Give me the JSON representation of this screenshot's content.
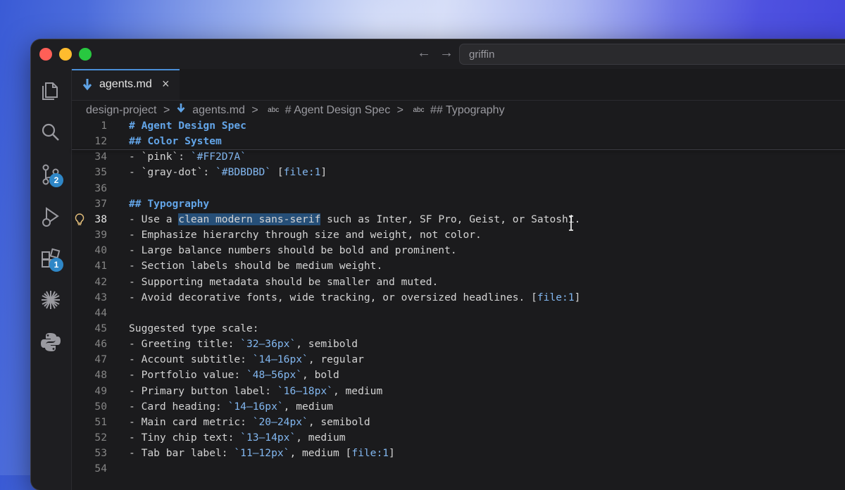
{
  "titlebar": {
    "search_text": "griffin"
  },
  "activity_bar": {
    "source_control_badge": "2",
    "extensions_badge": "1",
    "icons": [
      "explorer-icon",
      "search-icon",
      "source-control-icon",
      "run-debug-icon",
      "extensions-icon",
      "sparkle-icon",
      "python-icon"
    ]
  },
  "tab": {
    "filename": "agents.md"
  },
  "breadcrumb": {
    "folder": "design-project",
    "file": "agents.md",
    "section1": "# Agent Design Spec",
    "section2": "## Typography",
    "symbol_kind": "abc"
  },
  "editor": {
    "lines": [
      {
        "num": "1",
        "text": "# Agent Design Spec"
      },
      {
        "num": "12",
        "text": "## Color System"
      },
      {
        "num": "34",
        "pre": "- `pink`: ",
        "code": "`#FF2D7A`",
        "post": ""
      },
      {
        "num": "35",
        "pre": "- `gray-dot`: ",
        "code": "`#BDBDBD`",
        "post": " [",
        "ref": "file:1",
        "post2": "]"
      },
      {
        "num": "36",
        "text": ""
      },
      {
        "num": "37",
        "text": "## Typography"
      },
      {
        "num": "38",
        "pre": "- Use a ",
        "highlight": "clean modern sans-serif",
        "post": " such as Inter, SF Pro, Geist, or Satoshi."
      },
      {
        "num": "39",
        "text": "- Emphasize hierarchy through size and weight, not color."
      },
      {
        "num": "40",
        "text": "- Large balance numbers should be bold and prominent."
      },
      {
        "num": "41",
        "text": "- Section labels should be medium weight."
      },
      {
        "num": "42",
        "text": "- Supporting metadata should be smaller and muted."
      },
      {
        "num": "43",
        "pre": "- Avoid decorative fonts, wide tracking, or oversized headlines. [",
        "ref": "file:1",
        "post": "]"
      },
      {
        "num": "44",
        "text": ""
      },
      {
        "num": "45",
        "text": "Suggested type scale:"
      },
      {
        "num": "46",
        "pre": "- Greeting title: ",
        "code": "`32–36px`",
        "post": ", semibold"
      },
      {
        "num": "47",
        "pre": "- Account subtitle: ",
        "code": "`14–16px`",
        "post": ", regular"
      },
      {
        "num": "48",
        "pre": "- Portfolio value: ",
        "code": "`48–56px`",
        "post": ", bold"
      },
      {
        "num": "49",
        "pre": "- Primary button label: ",
        "code": "`16–18px`",
        "post": ", medium"
      },
      {
        "num": "50",
        "pre": "- Card heading: ",
        "code": "`14–16px`",
        "post": ", medium"
      },
      {
        "num": "51",
        "pre": "- Main card metric: ",
        "code": "`20–24px`",
        "post": ", semibold"
      },
      {
        "num": "52",
        "pre": "- Tiny chip text: ",
        "code": "`13–14px`",
        "post": ", medium"
      },
      {
        "num": "53",
        "pre": "- Tab bar label: ",
        "code": "`11–12px`",
        "post": ", medium [",
        "ref": "file:1",
        "post2": "]"
      },
      {
        "num": "54",
        "text": ""
      }
    ]
  }
}
